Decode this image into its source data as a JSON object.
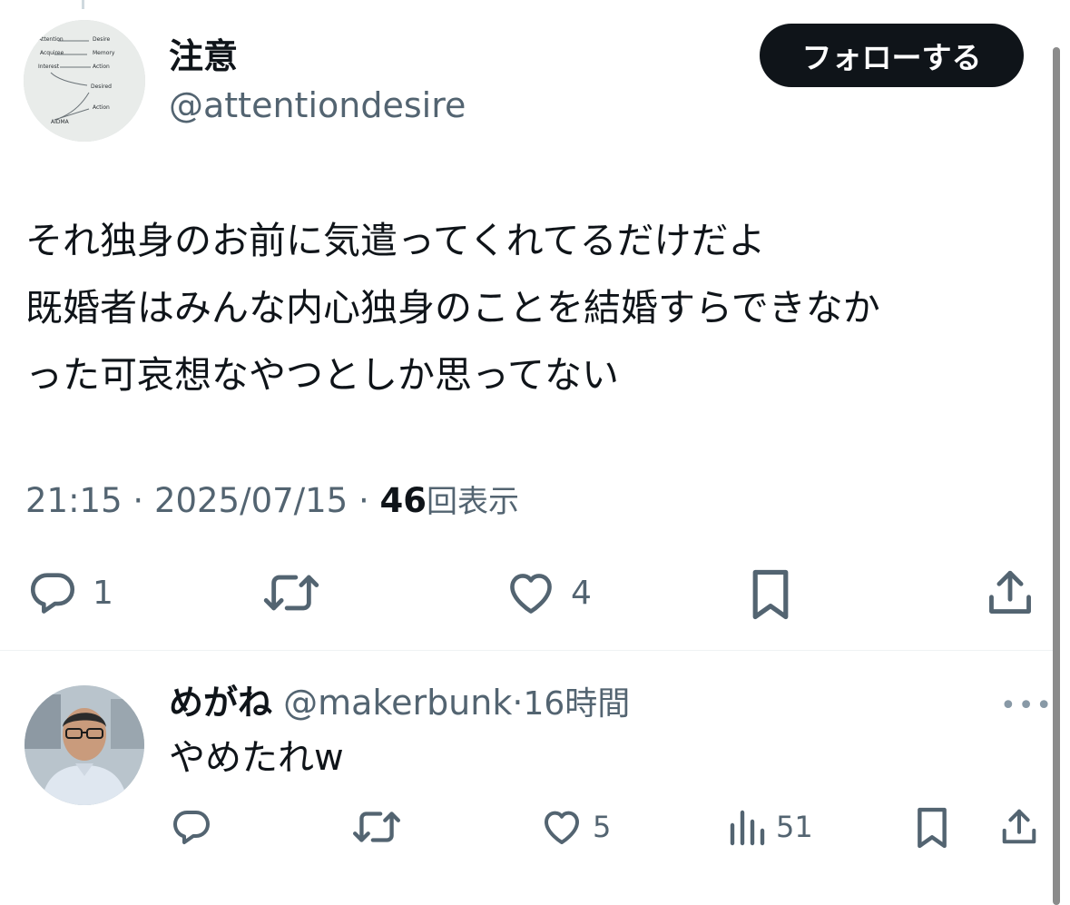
{
  "tweet": {
    "author": {
      "display_name": "注意",
      "handle": "@attentiondesire",
      "avatar_labels": [
        "Attention",
        "Desire",
        "Memory",
        "Acquiree",
        "Interest",
        "Action",
        "Desired",
        "Action",
        "AIDMA"
      ]
    },
    "follow_label": "フォローする",
    "text_lines": [
      "それ独身のお前に気遣ってくれてるだけだよ",
      "既婚者はみんな内心独身のことを結婚すらできなか",
      "った可哀想なやつとしか思ってない"
    ],
    "time": "21:15",
    "date": "2025/07/15",
    "separator": "·",
    "views_count": "46",
    "views_label": "回表示",
    "actions": {
      "reply_count": "1",
      "like_count": "4"
    }
  },
  "reply": {
    "display_name": "めがね",
    "handle": "@makerbunk",
    "separator": "·",
    "time_ago": "16時間",
    "text": "やめたれw",
    "more_label": "•••",
    "actions": {
      "like_count": "5",
      "views_count": "51"
    }
  },
  "colors": {
    "text": "#0f1419",
    "muted": "#536471",
    "follow_bg": "#0f1419",
    "divider": "#eff3f4"
  }
}
